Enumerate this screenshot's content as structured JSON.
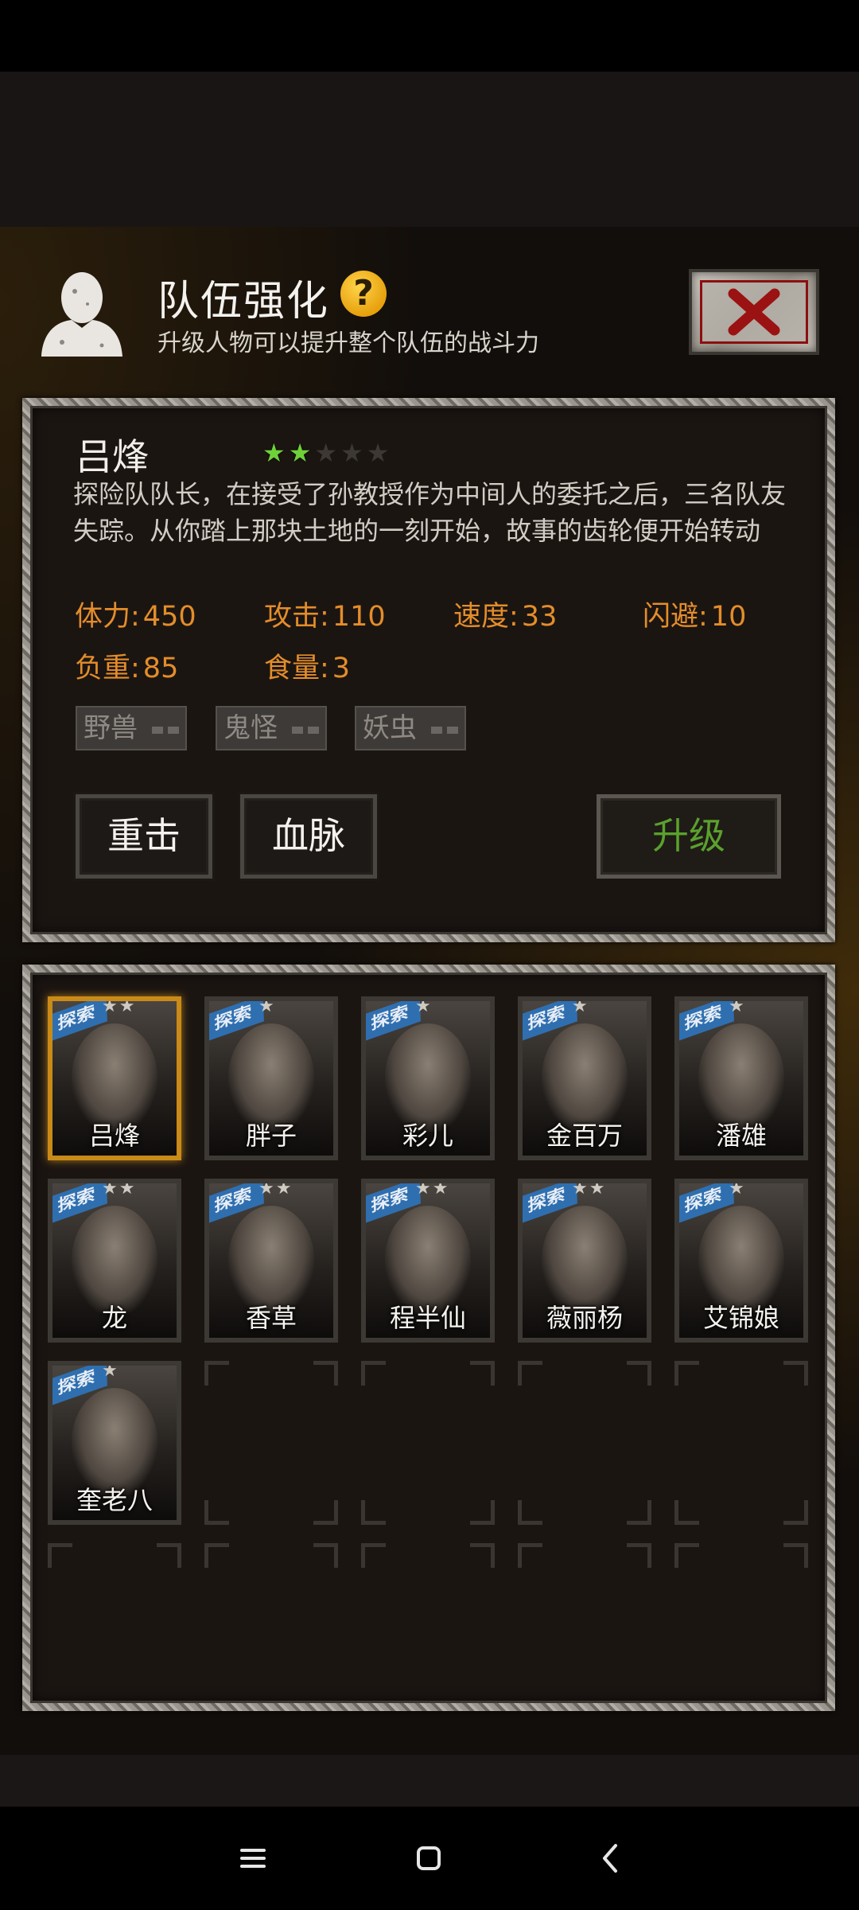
{
  "header": {
    "title": "队伍强化",
    "help_icon": "question-mark-icon",
    "subtitle": "升级人物可以提升整个队伍的战斗力"
  },
  "character": {
    "name": "吕烽",
    "rating": 2,
    "max_rating": 5,
    "description": "探险队队长，在接受了孙教授作为中间人的委托之后，三名队友失踪。从你踏上那块土地的一刻开始，故事的齿轮便开始转动",
    "stats": [
      {
        "label": "体力:",
        "value": "450"
      },
      {
        "label": "攻击:",
        "value": "110"
      },
      {
        "label": "速度:",
        "value": "33"
      },
      {
        "label": "闪避:",
        "value": "10"
      },
      {
        "label": "负重:",
        "value": "85"
      },
      {
        "label": "食量:",
        "value": "3"
      }
    ],
    "tags": [
      "野兽",
      "鬼怪",
      "妖虫"
    ],
    "skills": [
      "重击",
      "血脉"
    ],
    "upgrade_label": "升级"
  },
  "roster": {
    "explore_label": "探索",
    "members": [
      {
        "name": "吕烽",
        "stars": 2,
        "selected": true
      },
      {
        "name": "胖子",
        "stars": 1
      },
      {
        "name": "彩儿",
        "stars": 1
      },
      {
        "name": "金百万",
        "stars": 1
      },
      {
        "name": "潘雄",
        "stars": 1
      },
      {
        "name": "龙",
        "stars": 2
      },
      {
        "name": "香草",
        "stars": 2
      },
      {
        "name": "程半仙",
        "stars": 2
      },
      {
        "name": "薇丽杨",
        "stars": 2
      },
      {
        "name": "艾锦娘",
        "stars": 1
      },
      {
        "name": "奎老八",
        "stars": 1
      }
    ]
  },
  "colors": {
    "stat_text": "#e48d2a",
    "star_active": "#6fd13a",
    "upgrade_text": "#5aa12d",
    "selected_border": "#c98a18"
  }
}
